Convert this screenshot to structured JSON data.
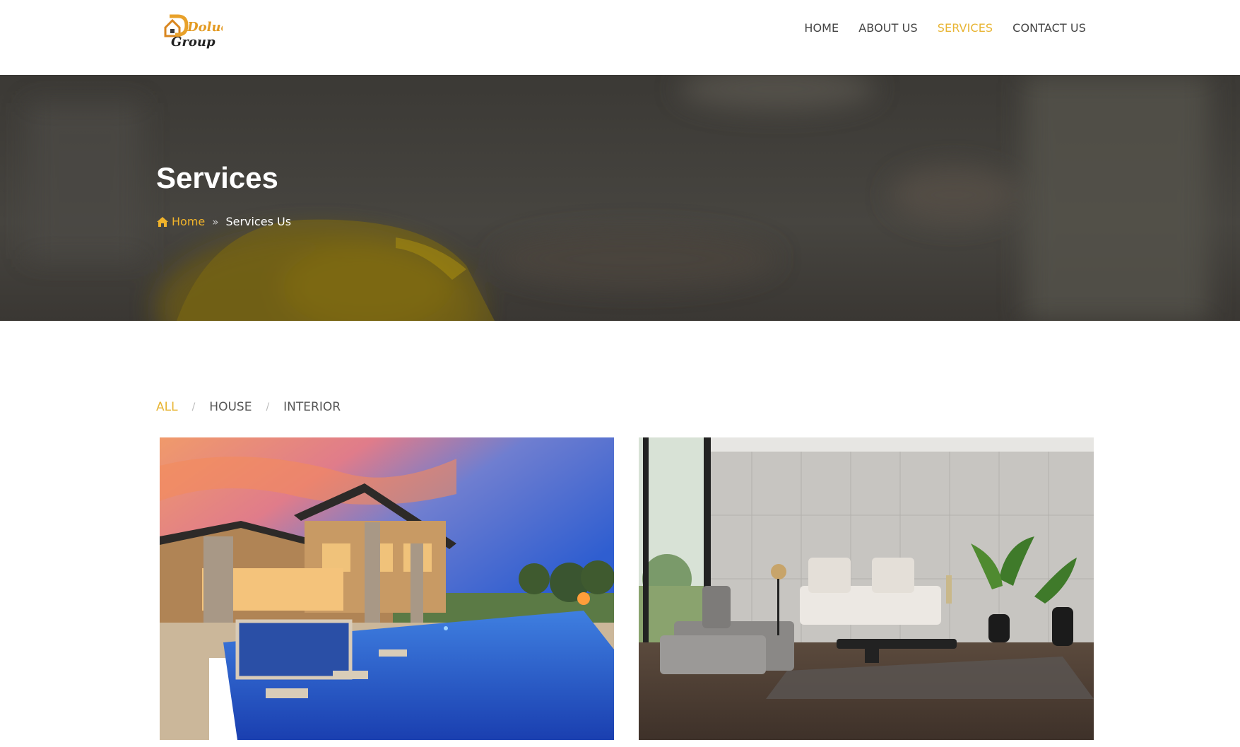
{
  "brand": {
    "logo_line1": "Dolue",
    "logo_line2": "Group",
    "accent_color": "#e8b534"
  },
  "nav": [
    {
      "label": "HOME",
      "active": false
    },
    {
      "label": "ABOUT US",
      "active": false
    },
    {
      "label": "SERVICES",
      "active": true
    },
    {
      "label": "CONTACT US",
      "active": false
    }
  ],
  "hero": {
    "title": "Services",
    "breadcrumb": {
      "home_label": "Home",
      "current": "Services Us"
    }
  },
  "filters": [
    {
      "label": "ALL",
      "active": true
    },
    {
      "label": "HOUSE",
      "active": false
    },
    {
      "label": "INTERIOR",
      "active": false
    }
  ],
  "gallery": [
    {
      "category": "HOUSE",
      "image": "house-with-pool-photo"
    },
    {
      "category": "INTERIOR",
      "image": "living-room-photo"
    }
  ]
}
